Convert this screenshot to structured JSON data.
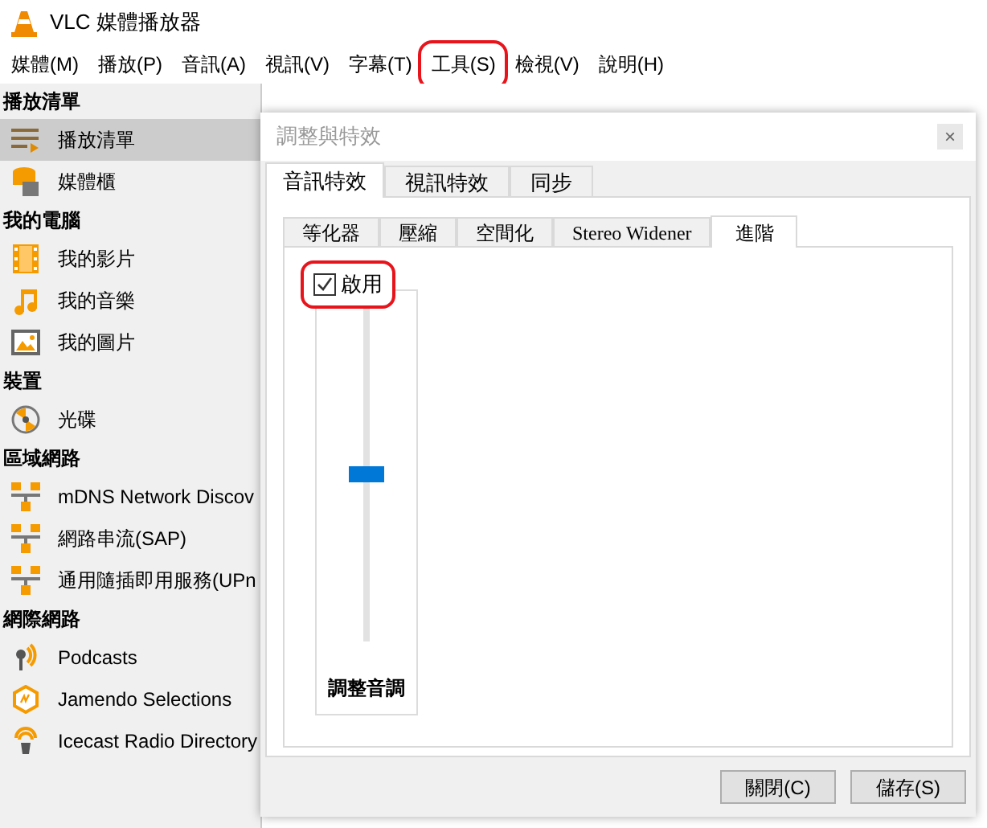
{
  "window": {
    "title": "VLC 媒體播放器"
  },
  "menu": [
    {
      "label": "媒體(M)",
      "highlighted": false
    },
    {
      "label": "播放(P)",
      "highlighted": false
    },
    {
      "label": "音訊(A)",
      "highlighted": false
    },
    {
      "label": "視訊(V)",
      "highlighted": false
    },
    {
      "label": "字幕(T)",
      "highlighted": false
    },
    {
      "label": "工具(S)",
      "highlighted": true
    },
    {
      "label": "檢視(V)",
      "highlighted": false
    },
    {
      "label": "說明(H)",
      "highlighted": false
    }
  ],
  "sidebar": {
    "sections": [
      {
        "title": "播放清單",
        "items": [
          {
            "label": "播放清單",
            "kind": "playlist",
            "selected": true
          },
          {
            "label": "媒體櫃",
            "kind": "library",
            "selected": false
          }
        ]
      },
      {
        "title": "我的電腦",
        "items": [
          {
            "label": "我的影片",
            "kind": "film",
            "selected": false
          },
          {
            "label": "我的音樂",
            "kind": "music",
            "selected": false
          },
          {
            "label": "我的圖片",
            "kind": "image",
            "selected": false
          }
        ]
      },
      {
        "title": "裝置",
        "items": [
          {
            "label": "光碟",
            "kind": "disc",
            "selected": false
          }
        ]
      },
      {
        "title": "區域網路",
        "items": [
          {
            "label": "mDNS Network Discov",
            "kind": "network",
            "selected": false
          },
          {
            "label": "網路串流(SAP)",
            "kind": "network",
            "selected": false
          },
          {
            "label": "通用隨插即用服務(UPn",
            "kind": "network",
            "selected": false
          }
        ]
      },
      {
        "title": "網際網路",
        "items": [
          {
            "label": "Podcasts",
            "kind": "podcast",
            "selected": false
          },
          {
            "label": "Jamendo Selections",
            "kind": "jamendo",
            "selected": false
          },
          {
            "label": "Icecast Radio Directory",
            "kind": "icecast",
            "selected": false
          }
        ]
      }
    ]
  },
  "dialog": {
    "title": "調整與特效",
    "close": "×",
    "tabs": [
      {
        "label": "音訊特效",
        "selected": true
      },
      {
        "label": "視訊特效",
        "selected": false
      },
      {
        "label": "同步",
        "selected": false
      }
    ],
    "subtabs": [
      {
        "label": "等化器",
        "selected": false
      },
      {
        "label": "壓縮",
        "selected": false
      },
      {
        "label": "空間化",
        "selected": false
      },
      {
        "label": "Stereo Widener",
        "selected": false
      },
      {
        "label": "進階",
        "selected": true
      }
    ],
    "enable": {
      "label": "啟用",
      "checked": true,
      "highlighted": true
    },
    "slider": {
      "label": "調整音調",
      "level": 0.5
    },
    "buttons": [
      "關閉(C)",
      "儲存(S)"
    ]
  }
}
